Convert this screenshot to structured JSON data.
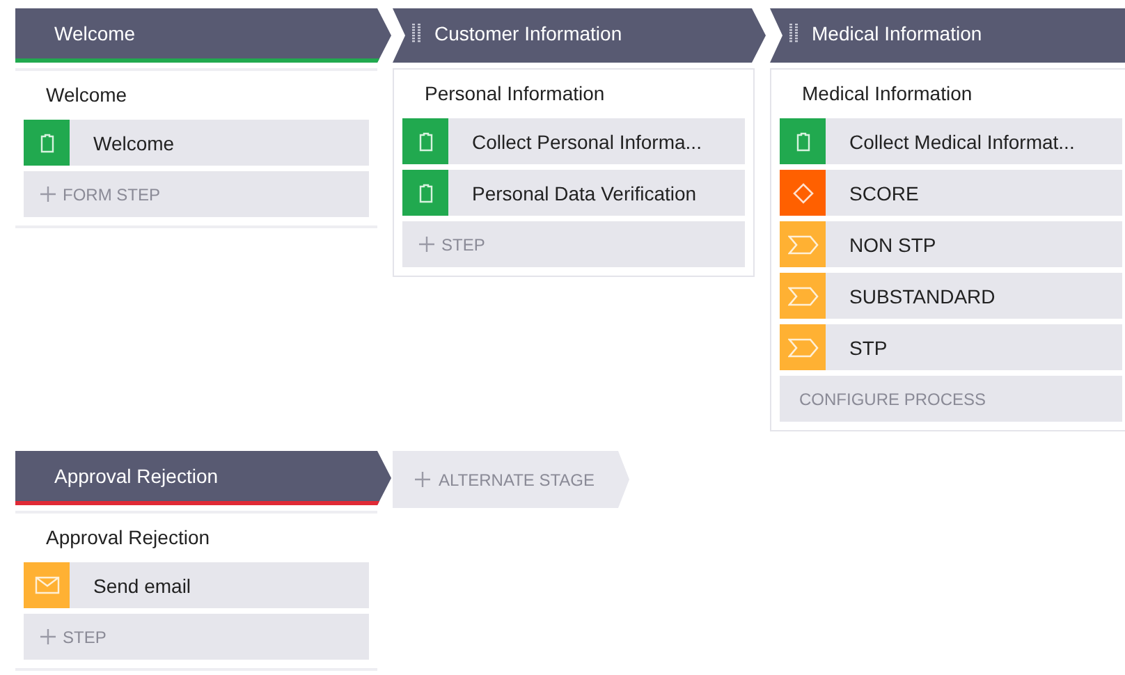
{
  "rows": [
    {
      "stages": [
        {
          "title": "Welcome",
          "draggable": false,
          "color": "#21a94f",
          "boxed": false,
          "processes": [
            {
              "title": "Welcome",
              "steps": [
                {
                  "kind": "form",
                  "label": "Welcome"
                }
              ],
              "add_button": {
                "kind": "add",
                "label": "FORM STEP"
              }
            }
          ]
        },
        {
          "title": "Customer Information",
          "draggable": true,
          "boxed": true,
          "processes": [
            {
              "title": "Personal Information",
              "steps": [
                {
                  "kind": "form",
                  "label": "Collect Personal Informa..."
                },
                {
                  "kind": "form",
                  "label": "Personal Data Verification"
                }
              ],
              "add_button": {
                "kind": "add",
                "label": "STEP"
              }
            }
          ]
        },
        {
          "title": "Medical Information",
          "draggable": true,
          "boxed": true,
          "processes": [
            {
              "title": "Medical Information",
              "steps": [
                {
                  "kind": "form",
                  "label": "Collect Medical Informat..."
                },
                {
                  "kind": "decision",
                  "label": "SCORE"
                },
                {
                  "kind": "branch",
                  "label": "NON STP"
                },
                {
                  "kind": "branch",
                  "label": "SUBSTANDARD"
                },
                {
                  "kind": "branch",
                  "label": "STP"
                }
              ],
              "add_button": {
                "kind": "configure",
                "label": "CONFIGURE PROCESS"
              }
            }
          ]
        }
      ]
    },
    {
      "stages": [
        {
          "title": "Approval Rejection",
          "draggable": false,
          "color": "#e02a36",
          "boxed": false,
          "processes": [
            {
              "title": "Approval Rejection",
              "steps": [
                {
                  "kind": "email",
                  "label": "Send email"
                }
              ],
              "add_button": {
                "kind": "add",
                "label": "STEP"
              }
            }
          ]
        }
      ],
      "add_stage": {
        "label": "ALTERNATE STAGE"
      }
    }
  ]
}
